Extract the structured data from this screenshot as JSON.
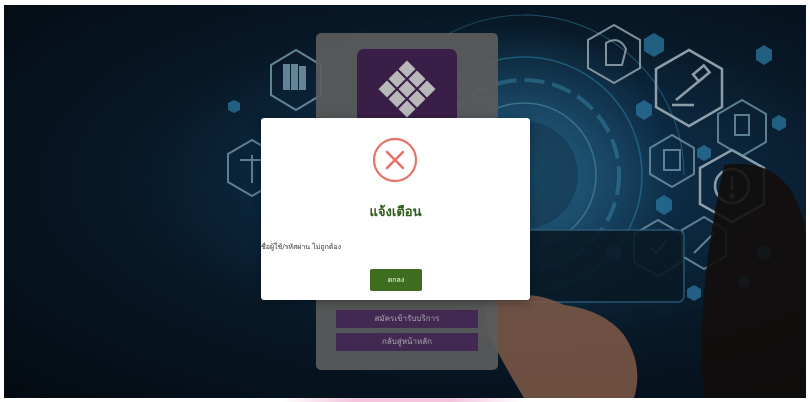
{
  "login_card": {
    "register_label": "สมัครเข้ารับบริการ",
    "home_label": "กลับสู่หน้าหลัก"
  },
  "alert": {
    "icon": "x-circle-icon",
    "title": "แจ้งเตือน",
    "message": "ชื่อผู้ใช้/รหัสผ่าน ไม่ถูกต้อง",
    "ok_label": "ตกลง"
  },
  "colors": {
    "error_icon": "#e8726a",
    "title_green": "#2e5d1a",
    "ok_button": "#3f6d1f",
    "card_button_purple": "#5b3a72",
    "logo_purple": "#4f2c63"
  }
}
